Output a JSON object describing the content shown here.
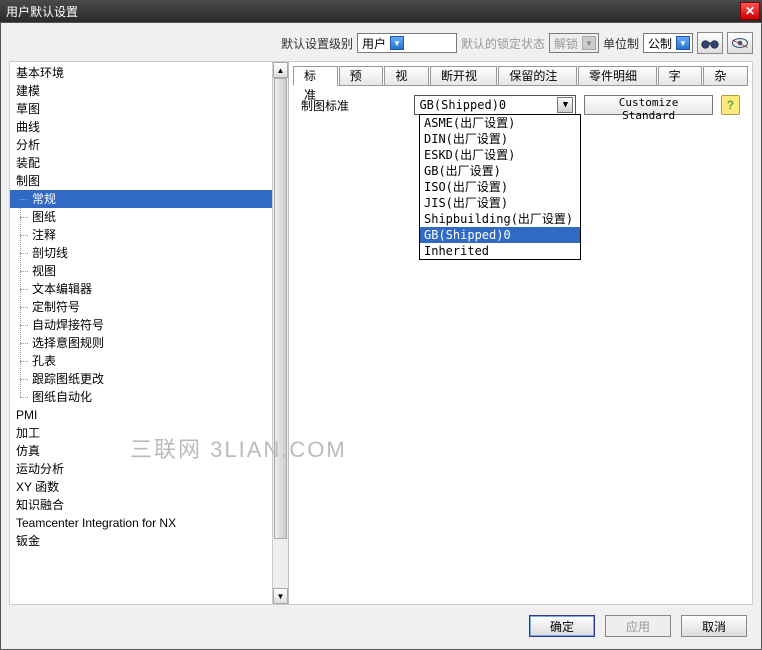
{
  "window_title": "用户默认设置",
  "toolbar": {
    "level_label": "默认设置级别",
    "level_value": "用户",
    "lock_label": "默认的锁定状态",
    "lock_value": "解锁",
    "unit_label": "单位制",
    "unit_value": "公制"
  },
  "tree": {
    "top": [
      "基本环境",
      "建模",
      "草图",
      "曲线",
      "分析",
      "装配"
    ],
    "drafting": "制图",
    "drafting_children": [
      "常规",
      "图纸",
      "注释",
      "剖切线",
      "视图",
      "文本编辑器",
      "定制符号",
      "自动焊接符号",
      "选择意图规则",
      "孔表",
      "跟踪图纸更改",
      "图纸自动化"
    ],
    "bottom": [
      "PMI",
      "加工",
      "仿真",
      "运动分析",
      "XY 函数",
      "知识融合",
      "Teamcenter Integration for NX",
      "钣金"
    ],
    "selected": "常规"
  },
  "tabs": [
    "标准",
    "预览",
    "视图",
    "断开视图",
    "保留的注释",
    "零件明细表",
    "字体",
    "杂项"
  ],
  "active_tab": 0,
  "panel": {
    "std_label": "制图标准",
    "std_value": "GB(Shipped)0",
    "customize": "Customize Standard",
    "options": [
      "ASME(出厂设置)",
      "DIN(出厂设置)",
      "ESKD(出厂设置)",
      "GB(出厂设置)",
      "ISO(出厂设置)",
      "JIS(出厂设置)",
      "Shipbuilding(出厂设置)",
      "GB(Shipped)0",
      "Inherited"
    ],
    "selected_option": 7
  },
  "buttons": {
    "ok": "确定",
    "apply": "应用",
    "cancel": "取消"
  },
  "watermark": "三联网 3LIAN.COM"
}
